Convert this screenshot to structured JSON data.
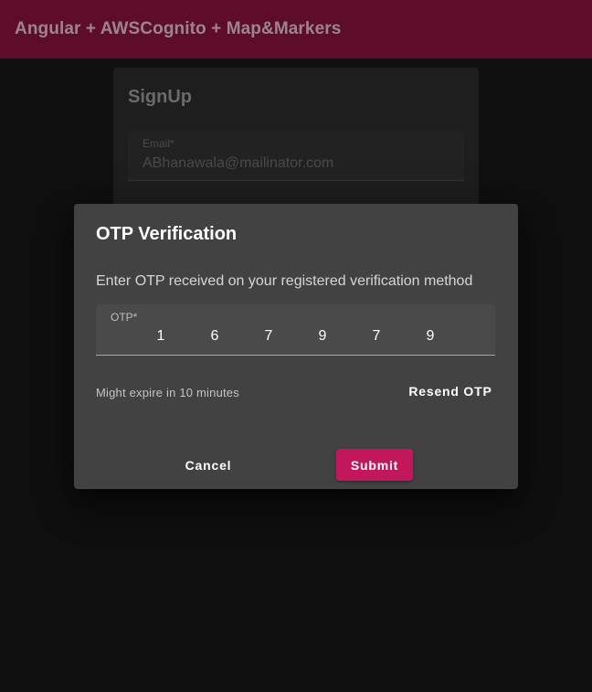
{
  "header": {
    "title": "Angular + AWSCognito + Map&Markers",
    "color": "#8a1240"
  },
  "signup": {
    "title": "SignUp",
    "email_label": "Email*",
    "email_value": "ABhanawala@mailinator.com"
  },
  "otp_dialog": {
    "title": "OTP Verification",
    "message": "Enter OTP received on your registered verification method",
    "otp_label": "OTP*",
    "otp_digits": [
      "1",
      "6",
      "7",
      "9",
      "7",
      "9"
    ],
    "expiry_note": "Might expire in 10 minutes",
    "resend_label": "Resend OTP",
    "cancel_label": "Cancel",
    "submit_label": "Submit",
    "accent_color": "#c2185b"
  }
}
